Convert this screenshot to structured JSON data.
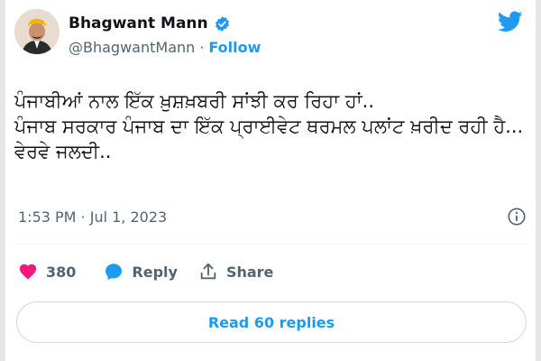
{
  "author": {
    "name": "Bhagwant Mann",
    "handle": "@BhagwantMann",
    "separator": "·",
    "follow_label": "Follow"
  },
  "tweet": {
    "lines": [
      "ਪੰਜਾਬੀਆਂ ਨਾਲ ਇੱਕ ਖ਼ੁਸ਼ਖ਼ਬਰੀ ਸਾਂਝੀ ਕਰ ਰਿਹਾ ਹਾਂ..",
      "ਪੰਜਾਬ ਸਰਕਾਰ ਪੰਜਾਬ ਦਾ ਇੱਕ ਪ੍ਰਾਈਵੇਟ ਥਰਮਲ ਪਲਾਂਟ ਖ਼ਰੀਦ ਰਹੀ ਹੈ...",
      "ਵੇਰਵੇ ਜਲਦੀ.."
    ],
    "timestamp": "1:53 PM · Jul 1, 2023"
  },
  "actions": {
    "like_count": "380",
    "reply_label": "Reply",
    "share_label": "Share"
  },
  "read_replies_label": "Read 60 replies",
  "colors": {
    "accent": "#1d9bf0",
    "like": "#f91880",
    "text": "#0f1419",
    "secondary": "#536471"
  },
  "icons": [
    "verified-badge-icon",
    "twitter-bird-icon",
    "info-icon",
    "heart-icon",
    "reply-bubble-icon",
    "share-icon"
  ]
}
